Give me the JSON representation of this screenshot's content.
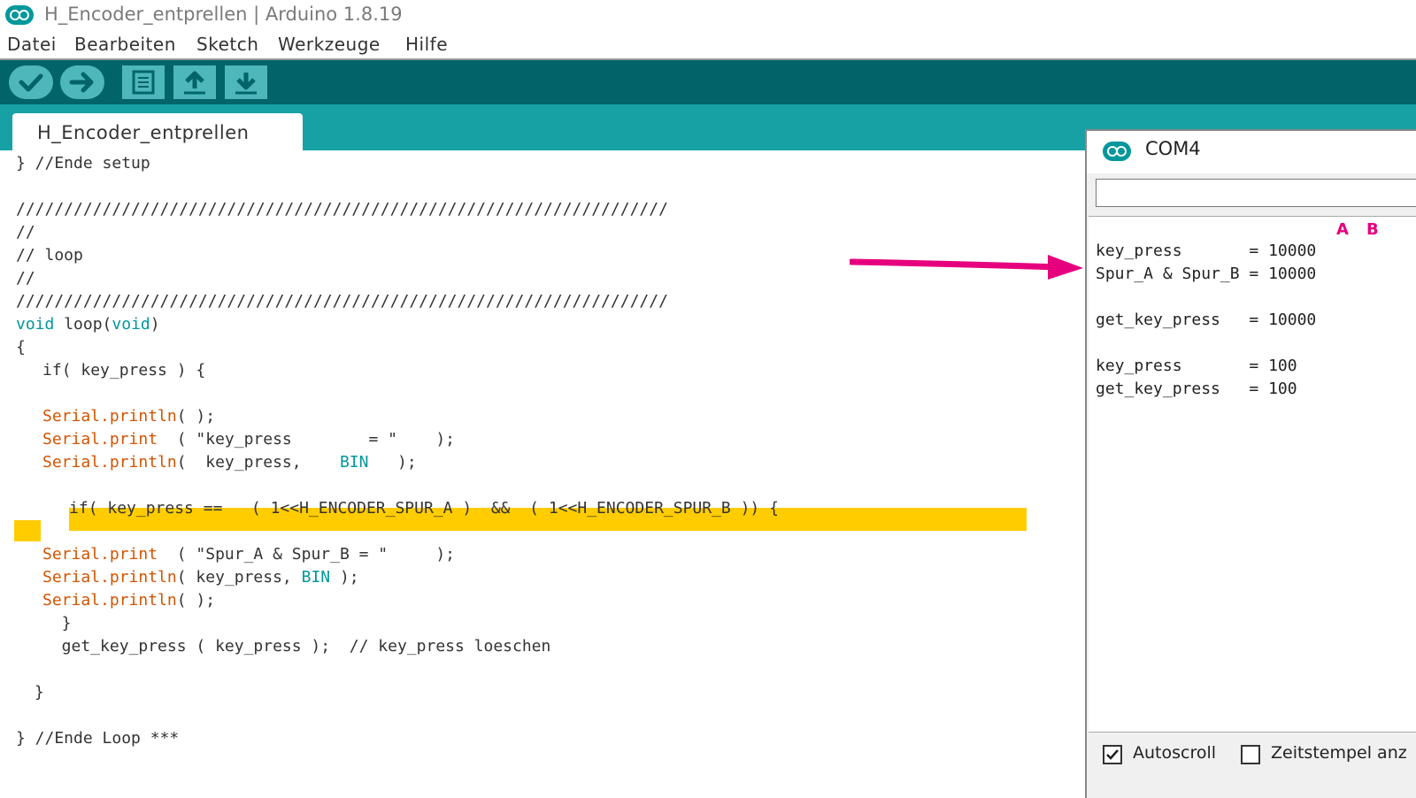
{
  "window": {
    "title": "H_Encoder_entprellen | Arduino 1.8.19"
  },
  "menu": [
    "Datei",
    "Bearbeiten",
    "Sketch",
    "Werkzeuge",
    "Hilfe"
  ],
  "toolbar": {
    "buttons": [
      {
        "name": "verify",
        "icon": "check-icon"
      },
      {
        "name": "upload",
        "icon": "arrow-right-icon"
      },
      {
        "name": "new",
        "icon": "new-file-icon"
      },
      {
        "name": "open",
        "icon": "arrow-up-icon"
      },
      {
        "name": "save",
        "icon": "arrow-down-icon"
      }
    ]
  },
  "tab": {
    "label": "H_Encoder_entprellen"
  },
  "code": {
    "l01": "} //Ende setup",
    "l03": "////////////////////////////////////////////////////////////////////",
    "l04": "//",
    "l05": "// loop",
    "l06": "//",
    "l07": "////////////////////////////////////////////////////////////////////",
    "l08_kw1": "void",
    "l08_mid": " loop(",
    "l08_kw2": "void",
    "l08_end": ")",
    "l09": "{",
    "l10_kw": "if",
    "l10_rest": "( key_press ) {",
    "l12_fn": "Serial.println",
    "l12_rest": "( );",
    "l13_fn": "Serial.print",
    "l13_rest": "  ( \"key_press        = \"    );",
    "l14_fn": "Serial.println",
    "l14_rest1": "(  key_press,    ",
    "l14_kw": "BIN",
    "l14_rest2": "   );",
    "l16_kw": "if",
    "l16_rest": "( key_press ==   ( 1<<H_ENCODER_SPUR_A )  &&  ( 1<<H_ENCODER_SPUR_B )) {",
    "l18_fn": "Serial.print",
    "l18_rest": "  ( \"Spur_A & Spur_B = \"     );",
    "l19_fn": "Serial.println",
    "l19_rest1": "( key_press, ",
    "l19_kw": "BIN",
    "l19_rest2": " );",
    "l20_fn": "Serial.println",
    "l20_rest": "( );",
    "l21": "  }",
    "l22": "  get_key_press ( key_press );  // key_press loeschen",
    "l24": " }",
    "l26": "} //Ende Loop ***"
  },
  "serial": {
    "title": "COM4",
    "input_value": "",
    "annotation_a": "A",
    "annotation_b": "B",
    "output": "key_press       = 10000\nSpur_A & Spur_B = 10000\n\nget_key_press   = 10000\n\nkey_press       = 100\nget_key_press   = 100",
    "autoscroll_label": "Autoscroll",
    "autoscroll_checked": true,
    "timestamp_label": "Zeitstempel anz",
    "timestamp_checked": false
  },
  "colors": {
    "toolbar_bg": "#006468",
    "tabbar_bg": "#17a1a5",
    "button_bg": "#4db7bb",
    "highlight": "#ffcc00",
    "keyword": "#00979c",
    "function": "#d35400",
    "annotation_arrow": "#e6007e"
  }
}
